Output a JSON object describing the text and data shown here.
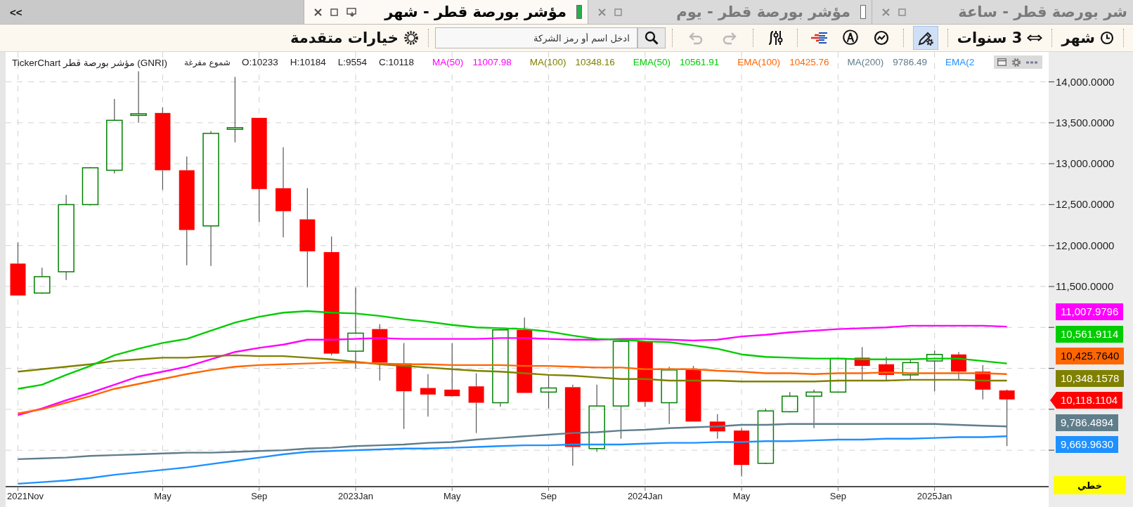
{
  "tab_bar": {
    "scroll_button": "<<",
    "tabs": [
      {
        "title": "شر بورصة قطر - ساعة",
        "selected": false
      },
      {
        "title": "مؤشر بورصة قطر - يوم",
        "selected": false,
        "color": "#ffffff"
      },
      {
        "title": "مؤشر بورصة قطر - شهر",
        "selected": true,
        "color": "#22b14c"
      }
    ]
  },
  "toolbar": {
    "interval": "شهر",
    "range": "3 سنوات",
    "tools": [
      {
        "selected": true
      },
      {
        "selected": false
      },
      {
        "selected": false,
        "glyph": "Ⓐ"
      },
      {
        "selected": false
      },
      {
        "selected": false
      }
    ],
    "history": [
      {
        "disabled": true
      },
      {
        "disabled": true
      }
    ],
    "search": {
      "placeholder": "ادخل اسم أو رمز الشركة"
    },
    "advanced_options": "خيارات متقدمة"
  },
  "chart": {
    "legend": {
      "title": "TickerChart مؤشر بورصة قطر (GNRI)",
      "style": "شموع مفرغة",
      "ohlc": [
        "O:10233",
        "H:10184",
        "L:9554",
        "C:10118"
      ],
      "readings": [
        "11007.98",
        "10348.16",
        "10561.91",
        "10425.76",
        "9786.49"
      ]
    },
    "chart_data": {
      "type": "line",
      "grid": true,
      "categories": [
        "2021Nov",
        null,
        null,
        null,
        null,
        null,
        "May",
        null,
        null,
        null,
        "Sep",
        null,
        null,
        null,
        "2023Jan",
        null,
        null,
        null,
        "May",
        null,
        null,
        null,
        "Sep",
        null,
        null,
        null,
        "2024Jan",
        null,
        null,
        null,
        "May",
        null,
        null,
        null,
        "Sep",
        null,
        null,
        null,
        "2025Jan",
        null,
        null,
        null
      ],
      "ylim": [
        9055,
        14365
      ],
      "yticks": [
        {
          "value": 14000,
          "label": "14,000.0000"
        },
        {
          "value": 13500,
          "label": "13,500.0000"
        },
        {
          "value": 13000,
          "label": "13,000.0000"
        },
        {
          "value": 12500,
          "label": "12,500.0000"
        },
        {
          "value": 12000,
          "label": "12,000.0000"
        },
        {
          "value": 11500,
          "label": "11,500.0000"
        }
      ],
      "series": [
        {
          "name": "MA(50)",
          "color": "#ff00ff",
          "values": [
            9930,
            10010,
            10110,
            10200,
            10300,
            10400,
            10460,
            10520,
            10610,
            10700,
            10750,
            10790,
            10850,
            10850,
            10860,
            10870,
            10860,
            10860,
            10860,
            10860,
            10870,
            10870,
            10860,
            10850,
            10850,
            10860,
            10860,
            10850,
            10840,
            10850,
            10890,
            10910,
            10940,
            10960,
            10980,
            10990,
            11000,
            11020,
            11020,
            11020,
            11020,
            11010
          ]
        },
        {
          "name": "MA(100)",
          "color": "#808000",
          "values": [
            10460,
            10490,
            10520,
            10550,
            10590,
            10610,
            10630,
            10630,
            10650,
            10660,
            10650,
            10650,
            10630,
            10610,
            10580,
            10550,
            10530,
            10510,
            10490,
            10470,
            10460,
            10440,
            10420,
            10410,
            10390,
            10370,
            10370,
            10350,
            10350,
            10350,
            10340,
            10340,
            10340,
            10340,
            10350,
            10350,
            10350,
            10360,
            10360,
            10360,
            10350,
            10350
          ]
        },
        {
          "name": "EMA(50)",
          "color": "#00cc00",
          "values": [
            10250,
            10300,
            10420,
            10530,
            10660,
            10740,
            10810,
            10860,
            10960,
            11060,
            11130,
            11180,
            11200,
            11180,
            11170,
            11140,
            11100,
            11070,
            11030,
            11000,
            10990,
            10980,
            10950,
            10900,
            10860,
            10850,
            10830,
            10820,
            10780,
            10740,
            10670,
            10640,
            10630,
            10620,
            10620,
            10610,
            10610,
            10610,
            10620,
            10620,
            10590,
            10560
          ]
        },
        {
          "name": "EMA(100)",
          "color": "#ff6600",
          "values": [
            9950,
            10000,
            10080,
            10160,
            10250,
            10310,
            10370,
            10430,
            10480,
            10520,
            10540,
            10550,
            10560,
            10570,
            10570,
            10560,
            10550,
            10550,
            10540,
            10540,
            10540,
            10530,
            10530,
            10520,
            10510,
            10510,
            10490,
            10490,
            10490,
            10470,
            10460,
            10440,
            10440,
            10430,
            10440,
            10440,
            10450,
            10440,
            10440,
            10440,
            10440,
            10430
          ]
        },
        {
          "name": "MA(200)",
          "color": "#607d8b",
          "values": [
            9390,
            9400,
            9410,
            9430,
            9440,
            9450,
            9460,
            9470,
            9470,
            9480,
            9490,
            9500,
            9520,
            9530,
            9550,
            9560,
            9570,
            9590,
            9600,
            9630,
            9650,
            9670,
            9690,
            9710,
            9720,
            9740,
            9750,
            9770,
            9780,
            9790,
            9810,
            9810,
            9820,
            9820,
            9820,
            9820,
            9820,
            9820,
            9820,
            9810,
            9800,
            9790
          ]
        },
        {
          "name": "EMA(2",
          "color": "#1e90ff",
          "values": [
            9090,
            9110,
            9130,
            9160,
            9200,
            9230,
            9260,
            9290,
            9330,
            9370,
            9410,
            9450,
            9480,
            9490,
            9500,
            9510,
            9520,
            9520,
            9530,
            9540,
            9550,
            9560,
            9560,
            9570,
            9570,
            9570,
            9580,
            9590,
            9590,
            9600,
            9600,
            9610,
            9610,
            9620,
            9630,
            9630,
            9640,
            9640,
            9650,
            9660,
            9660,
            9670
          ]
        }
      ]
    },
    "candles": [
      {
        "kind": "down"
      },
      {
        "kind": "up"
      },
      {
        "kind": "up"
      },
      {
        "kind": "up"
      },
      {
        "kind": "up"
      },
      {
        "kind": "up"
      },
      {
        "kind": "down"
      },
      {
        "kind": "down"
      },
      {
        "kind": "up"
      },
      {
        "kind": "up"
      },
      {
        "kind": "down"
      },
      {
        "kind": "down"
      },
      {
        "kind": "down"
      },
      {
        "kind": "down"
      },
      {
        "kind": "up"
      },
      {
        "kind": "down"
      },
      {
        "kind": "down"
      },
      {
        "kind": "down"
      },
      {
        "kind": "down"
      },
      {
        "kind": "down"
      },
      {
        "kind": "up"
      },
      {
        "kind": "down"
      },
      {
        "kind": "up"
      },
      {
        "kind": "down"
      },
      {
        "kind": "up"
      },
      {
        "kind": "up"
      },
      {
        "kind": "down"
      },
      {
        "kind": "up"
      },
      {
        "kind": "down"
      },
      {
        "kind": "down"
      },
      {
        "kind": "down"
      },
      {
        "kind": "up"
      },
      {
        "kind": "up"
      },
      {
        "kind": "up"
      },
      {
        "kind": "up"
      },
      {
        "kind": "down"
      },
      {
        "kind": "down"
      },
      {
        "kind": "up"
      },
      {
        "kind": "up"
      },
      {
        "kind": "down"
      },
      {
        "kind": "down"
      },
      {
        "kind": "down"
      }
    ],
    "price_labels": [
      {
        "text": "11,007.9796",
        "color": "#ff00ff",
        "kind": "indicator"
      },
      {
        "text": "10,561.9114",
        "color": "#00cc00",
        "kind": "indicator"
      },
      {
        "text": "10,425.7640",
        "color": "#ff6600",
        "kind": "indicator"
      },
      {
        "text": "10,348.1578",
        "color": "#808000",
        "kind": "indicator"
      },
      {
        "text": "10,118.1104",
        "color": "#ff0000",
        "kind": "price"
      },
      {
        "text": "9,786.4894",
        "color": "#607d8b",
        "kind": "indicator"
      },
      {
        "text": "9,669.9630",
        "color": "#1e90ff",
        "kind": "indicator"
      }
    ],
    "scale_button": "خطي"
  }
}
